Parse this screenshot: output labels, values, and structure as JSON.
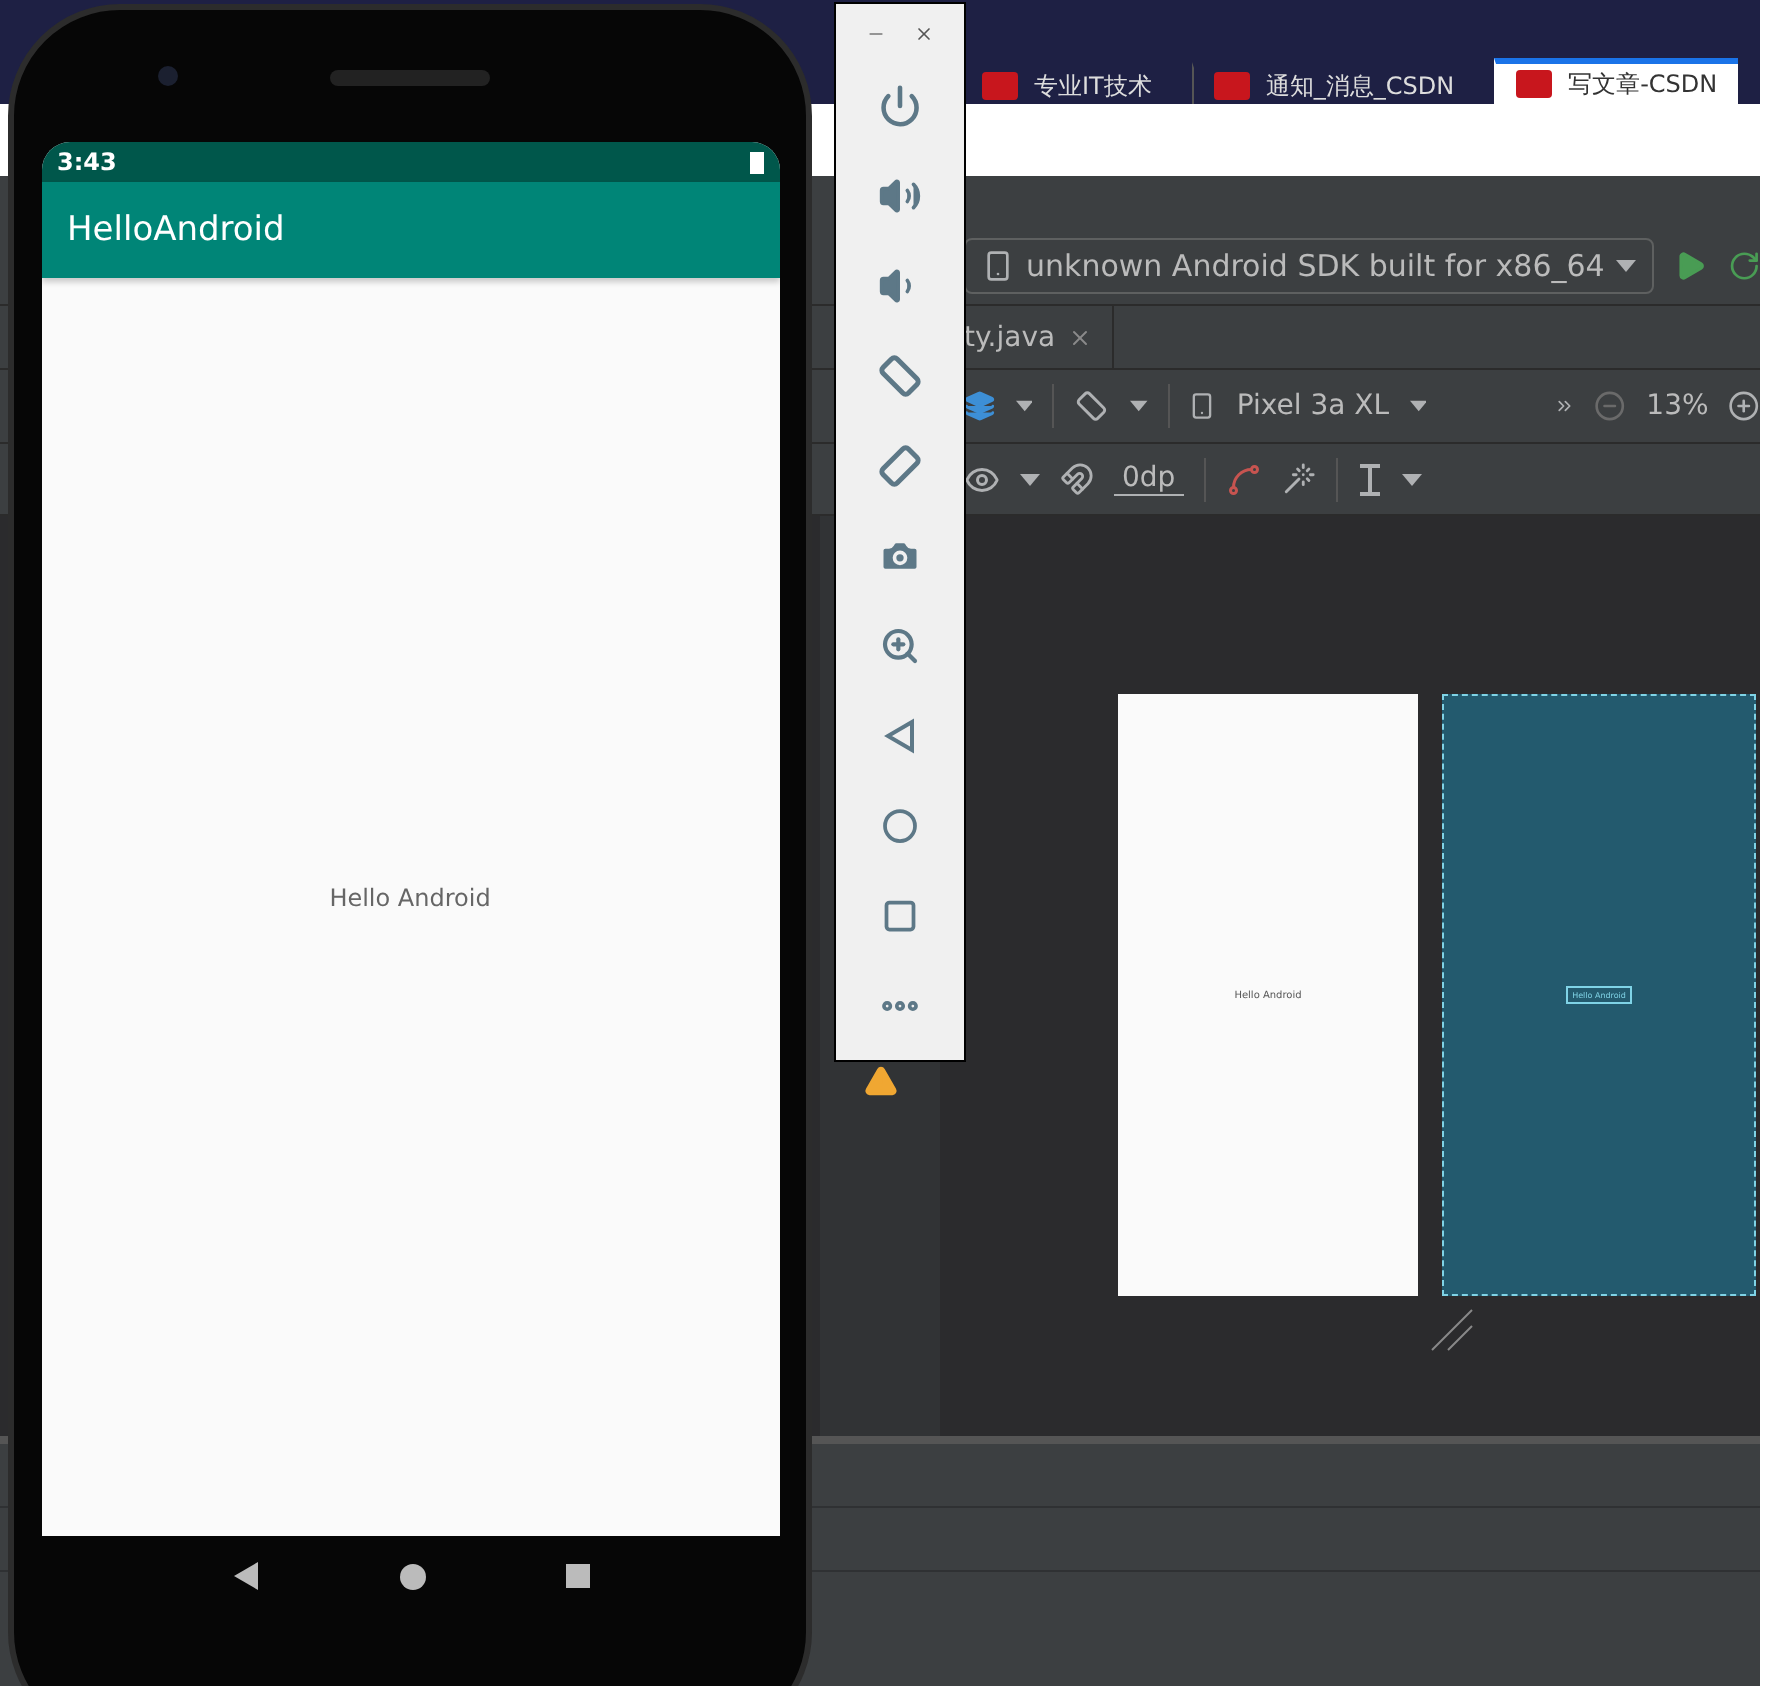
{
  "browser_tabs": [
    {
      "title": "专业IT技术",
      "selected": false
    },
    {
      "title": "通知_消息_CSDN",
      "selected": false
    },
    {
      "title": "写文章-CSDN",
      "selected": true
    }
  ],
  "phone": {
    "status_time": "3:43",
    "app_title": "HelloAndroid",
    "content_text": "Hello Android"
  },
  "studio": {
    "device_selector": "unknown Android SDK built for x86_64",
    "editor_tab": "ty.java",
    "device_model": "Pixel 3a XL",
    "zoom_level": "13%",
    "margin": "0dp",
    "preview_text": "Hello Android",
    "blueprint_text": "Hello Android"
  }
}
